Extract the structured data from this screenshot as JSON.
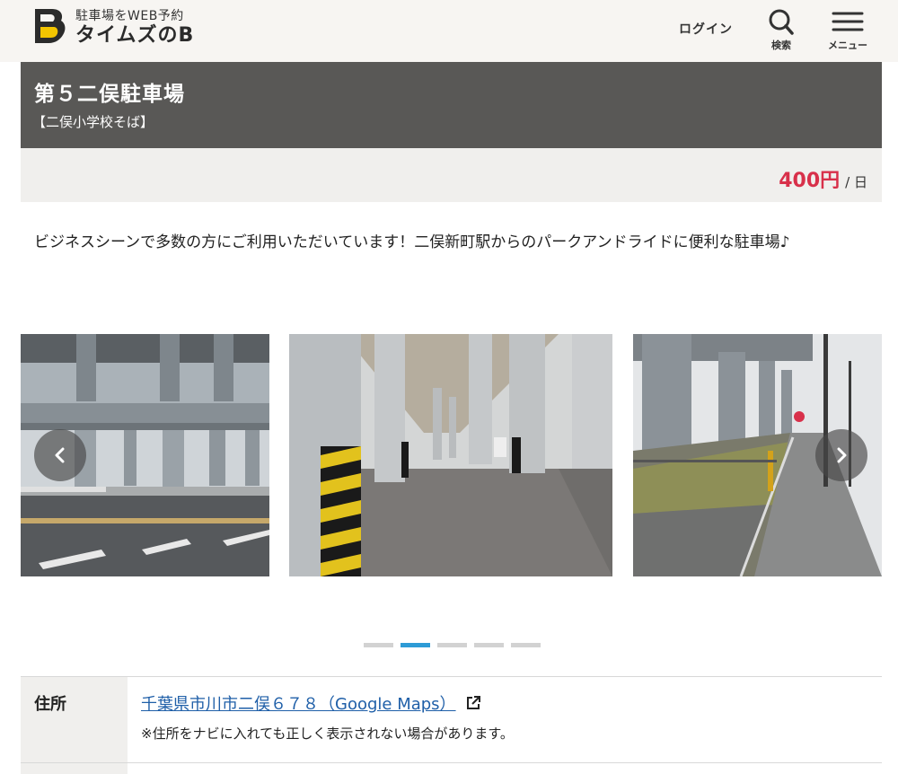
{
  "header": {
    "tagline": "駐車場をWEB予約",
    "brand": "タイムズのB",
    "login_label": "ログイン",
    "search_label": "検索",
    "menu_label": "メニュー"
  },
  "parking": {
    "name": "第５二俣駐車場",
    "subtitle": "【二俣小学校そば】",
    "price": "400円",
    "price_unit": "/ 日",
    "description": "ビジネスシーンで多数の方にご利用いただいています！二俣新町駅からのパークアンドライドに便利な駐車場♪"
  },
  "carousel": {
    "slide_count": 5,
    "active_index": 1
  },
  "info": {
    "address_label": "住所",
    "address_link": "千葉県市川市二俣６７８（Google Maps）",
    "address_note": "※住所をナビに入れても正しく表示されない場合があります。"
  },
  "colors": {
    "accent_price": "#d8304a",
    "title_band": "#595856",
    "active_dot": "#2d9bd6",
    "link": "#1f5fa8"
  }
}
